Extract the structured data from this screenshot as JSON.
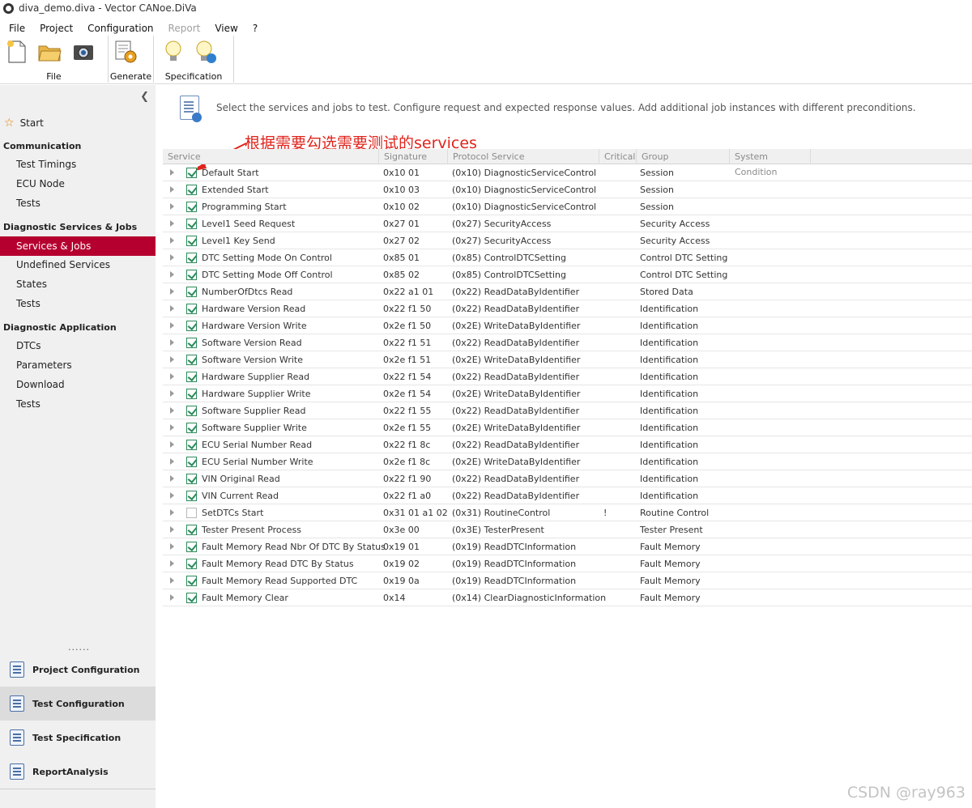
{
  "window": {
    "title": "diva_demo.diva - Vector CANoe.DiVa"
  },
  "menu": [
    {
      "label": "File",
      "disabled": false
    },
    {
      "label": "Project",
      "disabled": false
    },
    {
      "label": "Configuration",
      "disabled": false
    },
    {
      "label": "Report",
      "disabled": true
    },
    {
      "label": "View",
      "disabled": false
    },
    {
      "label": "?",
      "disabled": false
    }
  ],
  "ribbon": {
    "groups": {
      "file": "File",
      "generate": "Generate",
      "specification": "Specification"
    },
    "icons": [
      "new-file-icon",
      "open-folder-icon",
      "save-camera-icon",
      "generate-gear-icon",
      "lightbulb-icon",
      "lightbulb-refresh-icon"
    ]
  },
  "sidebar": {
    "start": "Start",
    "sections": {
      "communication": "Communication",
      "diag_services": "Diagnostic  Services  &  Jobs",
      "diag_app": "Diagnostic  Application"
    },
    "communication_items": [
      "Test Timings",
      "ECU Node",
      "Tests"
    ],
    "services_items": [
      "Services & Jobs",
      "Undefined Services",
      "States",
      "Tests"
    ],
    "app_items": [
      "DTCs",
      "Parameters",
      "Download",
      "Tests"
    ],
    "dots": "......",
    "bottom": [
      "Project Configuration",
      "Test Configuration",
      "Test Specification",
      "ReportAnalysis"
    ],
    "active_item": "Services & Jobs",
    "selected_bottom": "Test Configuration"
  },
  "main": {
    "info": "Select the services and jobs to test. Configure request and expected response values. Add additional job instances with different preconditions.",
    "annotation": "根据需要勾选需要测试的services",
    "columns": [
      "Service",
      "Signature",
      "Protocol Service",
      "Critical",
      "Group",
      "System Condition"
    ],
    "rows": [
      {
        "checked": true,
        "service": "Default Start",
        "signature": "0x10 01",
        "protocol": "(0x10) DiagnosticServiceControl",
        "critical": "",
        "group": "Session"
      },
      {
        "checked": true,
        "service": "Extended Start",
        "signature": "0x10 03",
        "protocol": "(0x10) DiagnosticServiceControl",
        "critical": "",
        "group": "Session"
      },
      {
        "checked": true,
        "service": "Programming Start",
        "signature": "0x10 02",
        "protocol": "(0x10) DiagnosticServiceControl",
        "critical": "",
        "group": "Session"
      },
      {
        "checked": true,
        "service": "Level1 Seed Request",
        "signature": "0x27 01",
        "protocol": "(0x27) SecurityAccess",
        "critical": "",
        "group": "Security Access"
      },
      {
        "checked": true,
        "service": "Level1 Key Send",
        "signature": "0x27 02",
        "protocol": "(0x27) SecurityAccess",
        "critical": "",
        "group": "Security Access"
      },
      {
        "checked": true,
        "service": "DTC Setting Mode On Control",
        "signature": "0x85 01",
        "protocol": "(0x85) ControlDTCSetting",
        "critical": "",
        "group": "Control DTC Setting"
      },
      {
        "checked": true,
        "service": "DTC Setting Mode Off Control",
        "signature": "0x85 02",
        "protocol": "(0x85) ControlDTCSetting",
        "critical": "",
        "group": "Control DTC Setting"
      },
      {
        "checked": true,
        "service": "NumberOfDtcs Read",
        "signature": "0x22 a1 01",
        "protocol": "(0x22) ReadDataByIdentifier",
        "critical": "",
        "group": "Stored Data"
      },
      {
        "checked": true,
        "service": "Hardware Version Read",
        "signature": "0x22 f1 50",
        "protocol": "(0x22) ReadDataByIdentifier",
        "critical": "",
        "group": "Identification"
      },
      {
        "checked": true,
        "service": "Hardware Version Write",
        "signature": "0x2e f1 50",
        "protocol": "(0x2E) WriteDataByIdentifier",
        "critical": "",
        "group": "Identification"
      },
      {
        "checked": true,
        "service": "Software Version Read",
        "signature": "0x22 f1 51",
        "protocol": "(0x22) ReadDataByIdentifier",
        "critical": "",
        "group": "Identification"
      },
      {
        "checked": true,
        "service": "Software Version Write",
        "signature": "0x2e f1 51",
        "protocol": "(0x2E) WriteDataByIdentifier",
        "critical": "",
        "group": "Identification"
      },
      {
        "checked": true,
        "service": "Hardware Supplier Read",
        "signature": "0x22 f1 54",
        "protocol": "(0x22) ReadDataByIdentifier",
        "critical": "",
        "group": "Identification"
      },
      {
        "checked": true,
        "service": "Hardware Supplier Write",
        "signature": "0x2e f1 54",
        "protocol": "(0x2E) WriteDataByIdentifier",
        "critical": "",
        "group": "Identification"
      },
      {
        "checked": true,
        "service": "Software Supplier Read",
        "signature": "0x22 f1 55",
        "protocol": "(0x22) ReadDataByIdentifier",
        "critical": "",
        "group": "Identification"
      },
      {
        "checked": true,
        "service": "Software Supplier Write",
        "signature": "0x2e f1 55",
        "protocol": "(0x2E) WriteDataByIdentifier",
        "critical": "",
        "group": "Identification"
      },
      {
        "checked": true,
        "service": "ECU Serial Number Read",
        "signature": "0x22 f1 8c",
        "protocol": "(0x22) ReadDataByIdentifier",
        "critical": "",
        "group": "Identification"
      },
      {
        "checked": true,
        "service": "ECU Serial Number Write",
        "signature": "0x2e f1 8c",
        "protocol": "(0x2E) WriteDataByIdentifier",
        "critical": "",
        "group": "Identification"
      },
      {
        "checked": true,
        "service": "VIN Original Read",
        "signature": "0x22 f1 90",
        "protocol": "(0x22) ReadDataByIdentifier",
        "critical": "",
        "group": "Identification"
      },
      {
        "checked": true,
        "service": "VIN Current Read",
        "signature": "0x22 f1 a0",
        "protocol": "(0x22) ReadDataByIdentifier",
        "critical": "",
        "group": "Identification"
      },
      {
        "checked": false,
        "service": "SetDTCs Start",
        "signature": "0x31 01 a1 02",
        "protocol": "(0x31) RoutineControl",
        "critical": "!",
        "group": "Routine Control"
      },
      {
        "checked": true,
        "service": "Tester Present Process",
        "signature": "0x3e 00",
        "protocol": "(0x3E) TesterPresent",
        "critical": "",
        "group": "Tester Present"
      },
      {
        "checked": true,
        "service": "Fault Memory Read Nbr Of DTC By Status",
        "signature": "0x19 01",
        "protocol": "(0x19) ReadDTCInformation",
        "critical": "",
        "group": "Fault Memory"
      },
      {
        "checked": true,
        "service": "Fault Memory Read DTC By Status",
        "signature": "0x19 02",
        "protocol": "(0x19) ReadDTCInformation",
        "critical": "",
        "group": "Fault Memory"
      },
      {
        "checked": true,
        "service": "Fault Memory Read Supported DTC",
        "signature": "0x19 0a",
        "protocol": "(0x19) ReadDTCInformation",
        "critical": "",
        "group": "Fault Memory"
      },
      {
        "checked": true,
        "service": "Fault Memory Clear",
        "signature": "0x14",
        "protocol": "(0x14) ClearDiagnosticInformation",
        "critical": "",
        "group": "Fault Memory"
      }
    ]
  },
  "watermark": "CSDN @ray963",
  "colors": {
    "active": "#b5002f",
    "annotation": "#e0241c",
    "check": "#2b8a5a"
  }
}
